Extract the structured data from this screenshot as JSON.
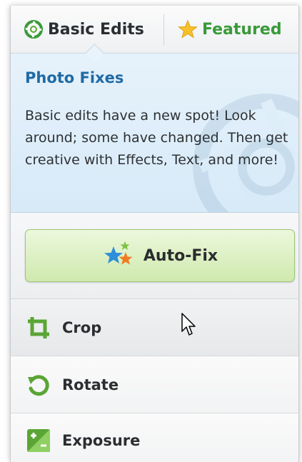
{
  "tabs": {
    "basic": {
      "label": "Basic Edits",
      "icon": "aperture-icon"
    },
    "featured": {
      "label": "Featured",
      "icon": "star-icon"
    }
  },
  "info": {
    "title": "Photo Fixes",
    "body": "Basic edits have a new spot! Look around; some have changed. Then get creative with Effects, Text, and more!"
  },
  "autofix": {
    "label": "Auto-Fix",
    "icon": "stars-icon"
  },
  "tools": [
    {
      "label": "Crop",
      "icon": "crop-icon"
    },
    {
      "label": "Rotate",
      "icon": "rotate-icon"
    },
    {
      "label": "Exposure",
      "icon": "exposure-icon"
    }
  ],
  "colors": {
    "tab_featured_text": "#3a9a3a",
    "info_title": "#1f6aa5",
    "info_bg": "#e6f2fb",
    "autofix_bg": "#cfe9ae",
    "accent_green": "#5aa534"
  }
}
